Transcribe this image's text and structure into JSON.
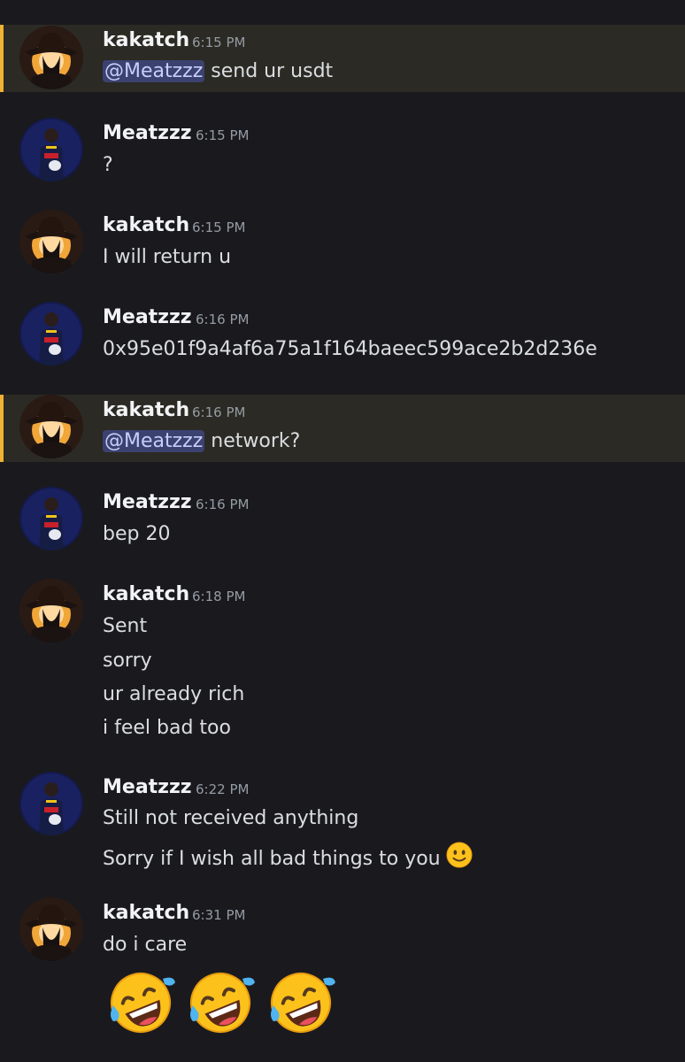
{
  "messages": [
    {
      "author": "kakatch",
      "time": "6:15 PM",
      "mention": "@Meatzzz",
      "text": "send ur usdt"
    },
    {
      "author": "Meatzzz",
      "time": "6:15 PM",
      "text": "?"
    },
    {
      "author": "kakatch",
      "time": "6:15 PM",
      "text": "I will return u"
    },
    {
      "author": "Meatzzz",
      "time": "6:16 PM",
      "text": "0x95e01f9a4af6a75a1f164baeec599ace2b2d236e"
    },
    {
      "author": "kakatch",
      "time": "6:16 PM",
      "mention": "@Meatzzz",
      "text": "network?"
    },
    {
      "author": "Meatzzz",
      "time": "6:16 PM",
      "text": "bep 20"
    },
    {
      "author": "kakatch",
      "time": "6:18 PM",
      "lines": [
        "Sent",
        "sorry",
        "ur already rich",
        "i feel bad too"
      ]
    },
    {
      "author": "Meatzzz",
      "time": "6:22 PM",
      "lines": [
        "Still not received anything",
        "Sorry if I wish all bad things to you"
      ]
    },
    {
      "author": "kakatch",
      "time": "6:31 PM",
      "lines": [
        "do i care"
      ]
    }
  ],
  "icons": {
    "kakatch_avatar": "cowboy-hat-avatar-icon",
    "meatzzz_avatar": "racing-driver-avatar-icon",
    "slight_smile": "slightly-smiling-face-emoji",
    "rofl": "rolling-on-floor-laughing-emoji"
  },
  "colors": {
    "background": "#1a1a1e",
    "mention_highlight": "#2b2a24",
    "mention_bar": "#f0b232",
    "mention_pill": "#3c4270",
    "mention_text": "#c9cdfb",
    "username": "#f2f3f5",
    "timestamp": "#949ba4",
    "message_text": "#dbdee1"
  }
}
